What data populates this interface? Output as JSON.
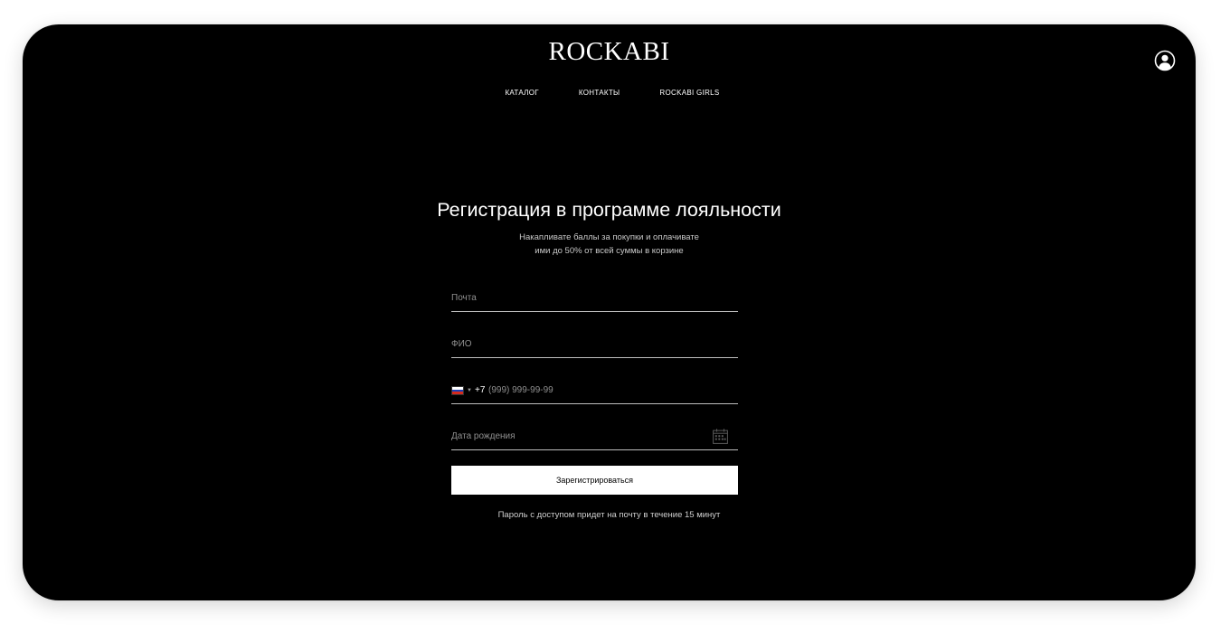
{
  "header": {
    "logo": "ROCKABI",
    "nav": [
      {
        "label": "КАТАЛОГ"
      },
      {
        "label": "КОНТАКТЫ"
      },
      {
        "label": "ROCKABI GIRLS"
      }
    ],
    "account_icon": "user-circle-icon"
  },
  "form": {
    "title": "Регистрация в программе лояльности",
    "subtitle_line1": "Накапливате баллы за покупки и оплачивате",
    "subtitle_line2": "ими до 50% от всей суммы в корзине",
    "email_placeholder": "Почта",
    "name_placeholder": "ФИО",
    "phone": {
      "country_flag": "russia-flag-icon",
      "code": "+7",
      "placeholder": "(999) 999-99-99"
    },
    "birthdate_placeholder": "Дата рождения",
    "calendar_icon": "calendar-icon",
    "submit_label": "Зарегистрироваться",
    "note": "Пароль с доступом придет на почту в течение 15 минут"
  },
  "colors": {
    "background": "#000000",
    "text": "#ffffff",
    "button_bg": "#ffffff",
    "button_text": "#000000",
    "flag_white": "#ffffff",
    "flag_blue": "#1c3fb8",
    "flag_red": "#d52b1e"
  }
}
